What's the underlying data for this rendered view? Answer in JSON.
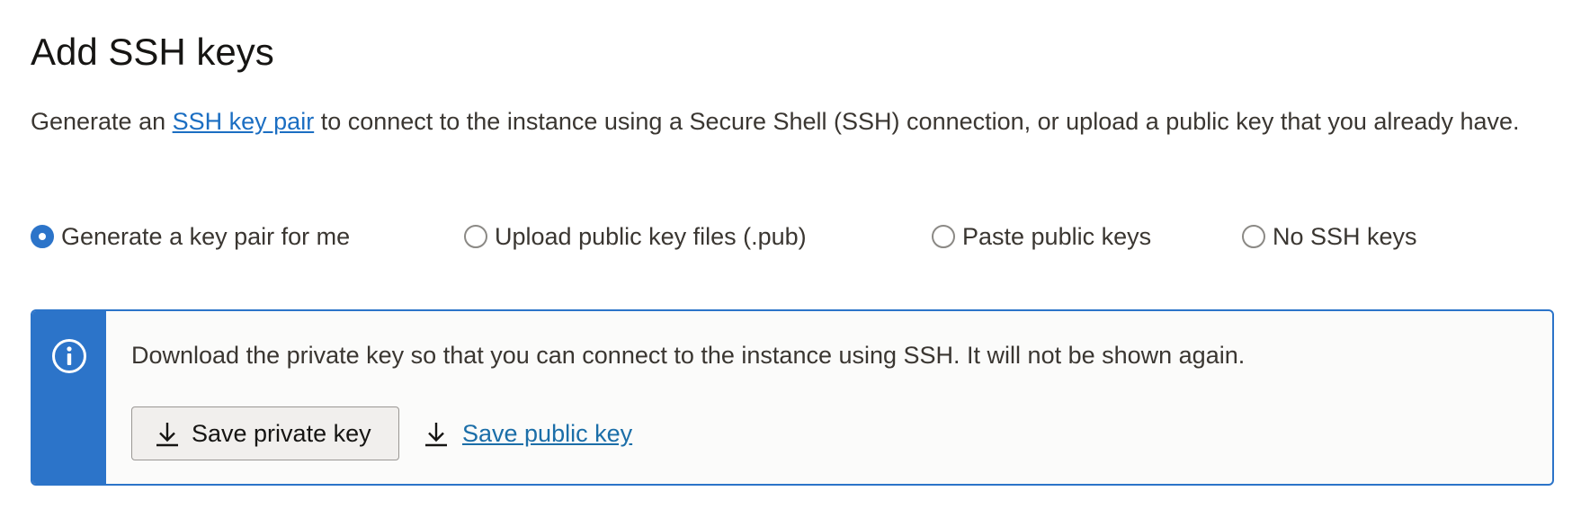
{
  "section": {
    "title": "Add SSH keys",
    "description_prefix": "Generate an ",
    "description_link": "SSH key pair",
    "description_suffix": " to connect to the instance using a Secure Shell (SSH) connection, or upload a public key that you already have."
  },
  "key_options": {
    "selected": "Generate a key pair for me",
    "items": [
      {
        "label": "Generate a key pair for me",
        "checked": true
      },
      {
        "label": "Upload public key files (.pub)",
        "checked": false
      },
      {
        "label": "Paste public keys",
        "checked": false
      },
      {
        "label": "No SSH keys",
        "checked": false
      }
    ]
  },
  "notice": {
    "icon": "info-icon",
    "message": "Download the private key so that you can connect to the instance using SSH. It will not be shown again.",
    "save_private_label": "Save private key",
    "save_public_label": "Save public key",
    "download_icon": "download-icon"
  },
  "colors": {
    "accent": "#2c74c9",
    "link": "#1b6ec2",
    "text": "#3a3631"
  }
}
